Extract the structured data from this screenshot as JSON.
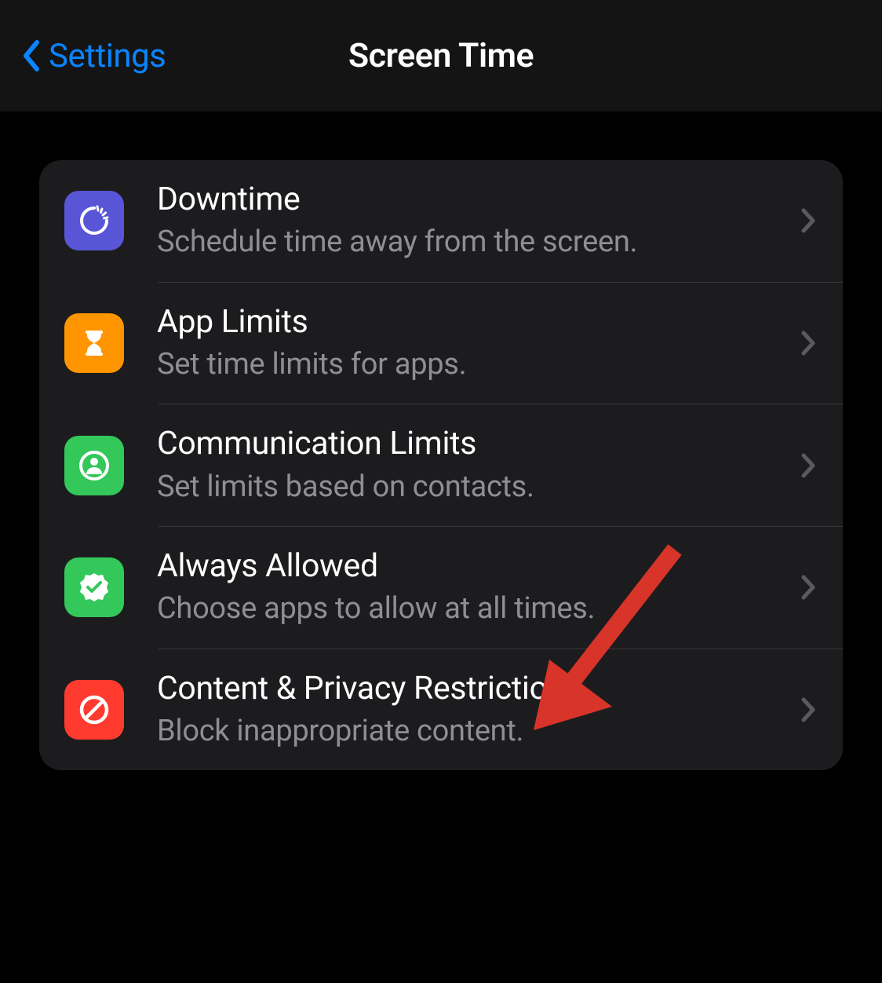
{
  "navbar": {
    "back_label": "Settings",
    "title": "Screen Time"
  },
  "rows": [
    {
      "icon": "downtime-icon",
      "icon_color": "purple",
      "title": "Downtime",
      "subtitle": "Schedule time away from the screen."
    },
    {
      "icon": "hourglass-icon",
      "icon_color": "orange",
      "title": "App Limits",
      "subtitle": "Set time limits for apps."
    },
    {
      "icon": "person-circle-icon",
      "icon_color": "green",
      "title": "Communication Limits",
      "subtitle": "Set limits based on contacts."
    },
    {
      "icon": "checkmark-seal-icon",
      "icon_color": "green",
      "title": "Always Allowed",
      "subtitle": "Choose apps to allow at all times."
    },
    {
      "icon": "nosign-icon",
      "icon_color": "red",
      "title": "Content & Privacy Restrictions",
      "subtitle": "Block inappropriate content."
    }
  ],
  "annotation": {
    "arrow_color": "#d8342a"
  }
}
